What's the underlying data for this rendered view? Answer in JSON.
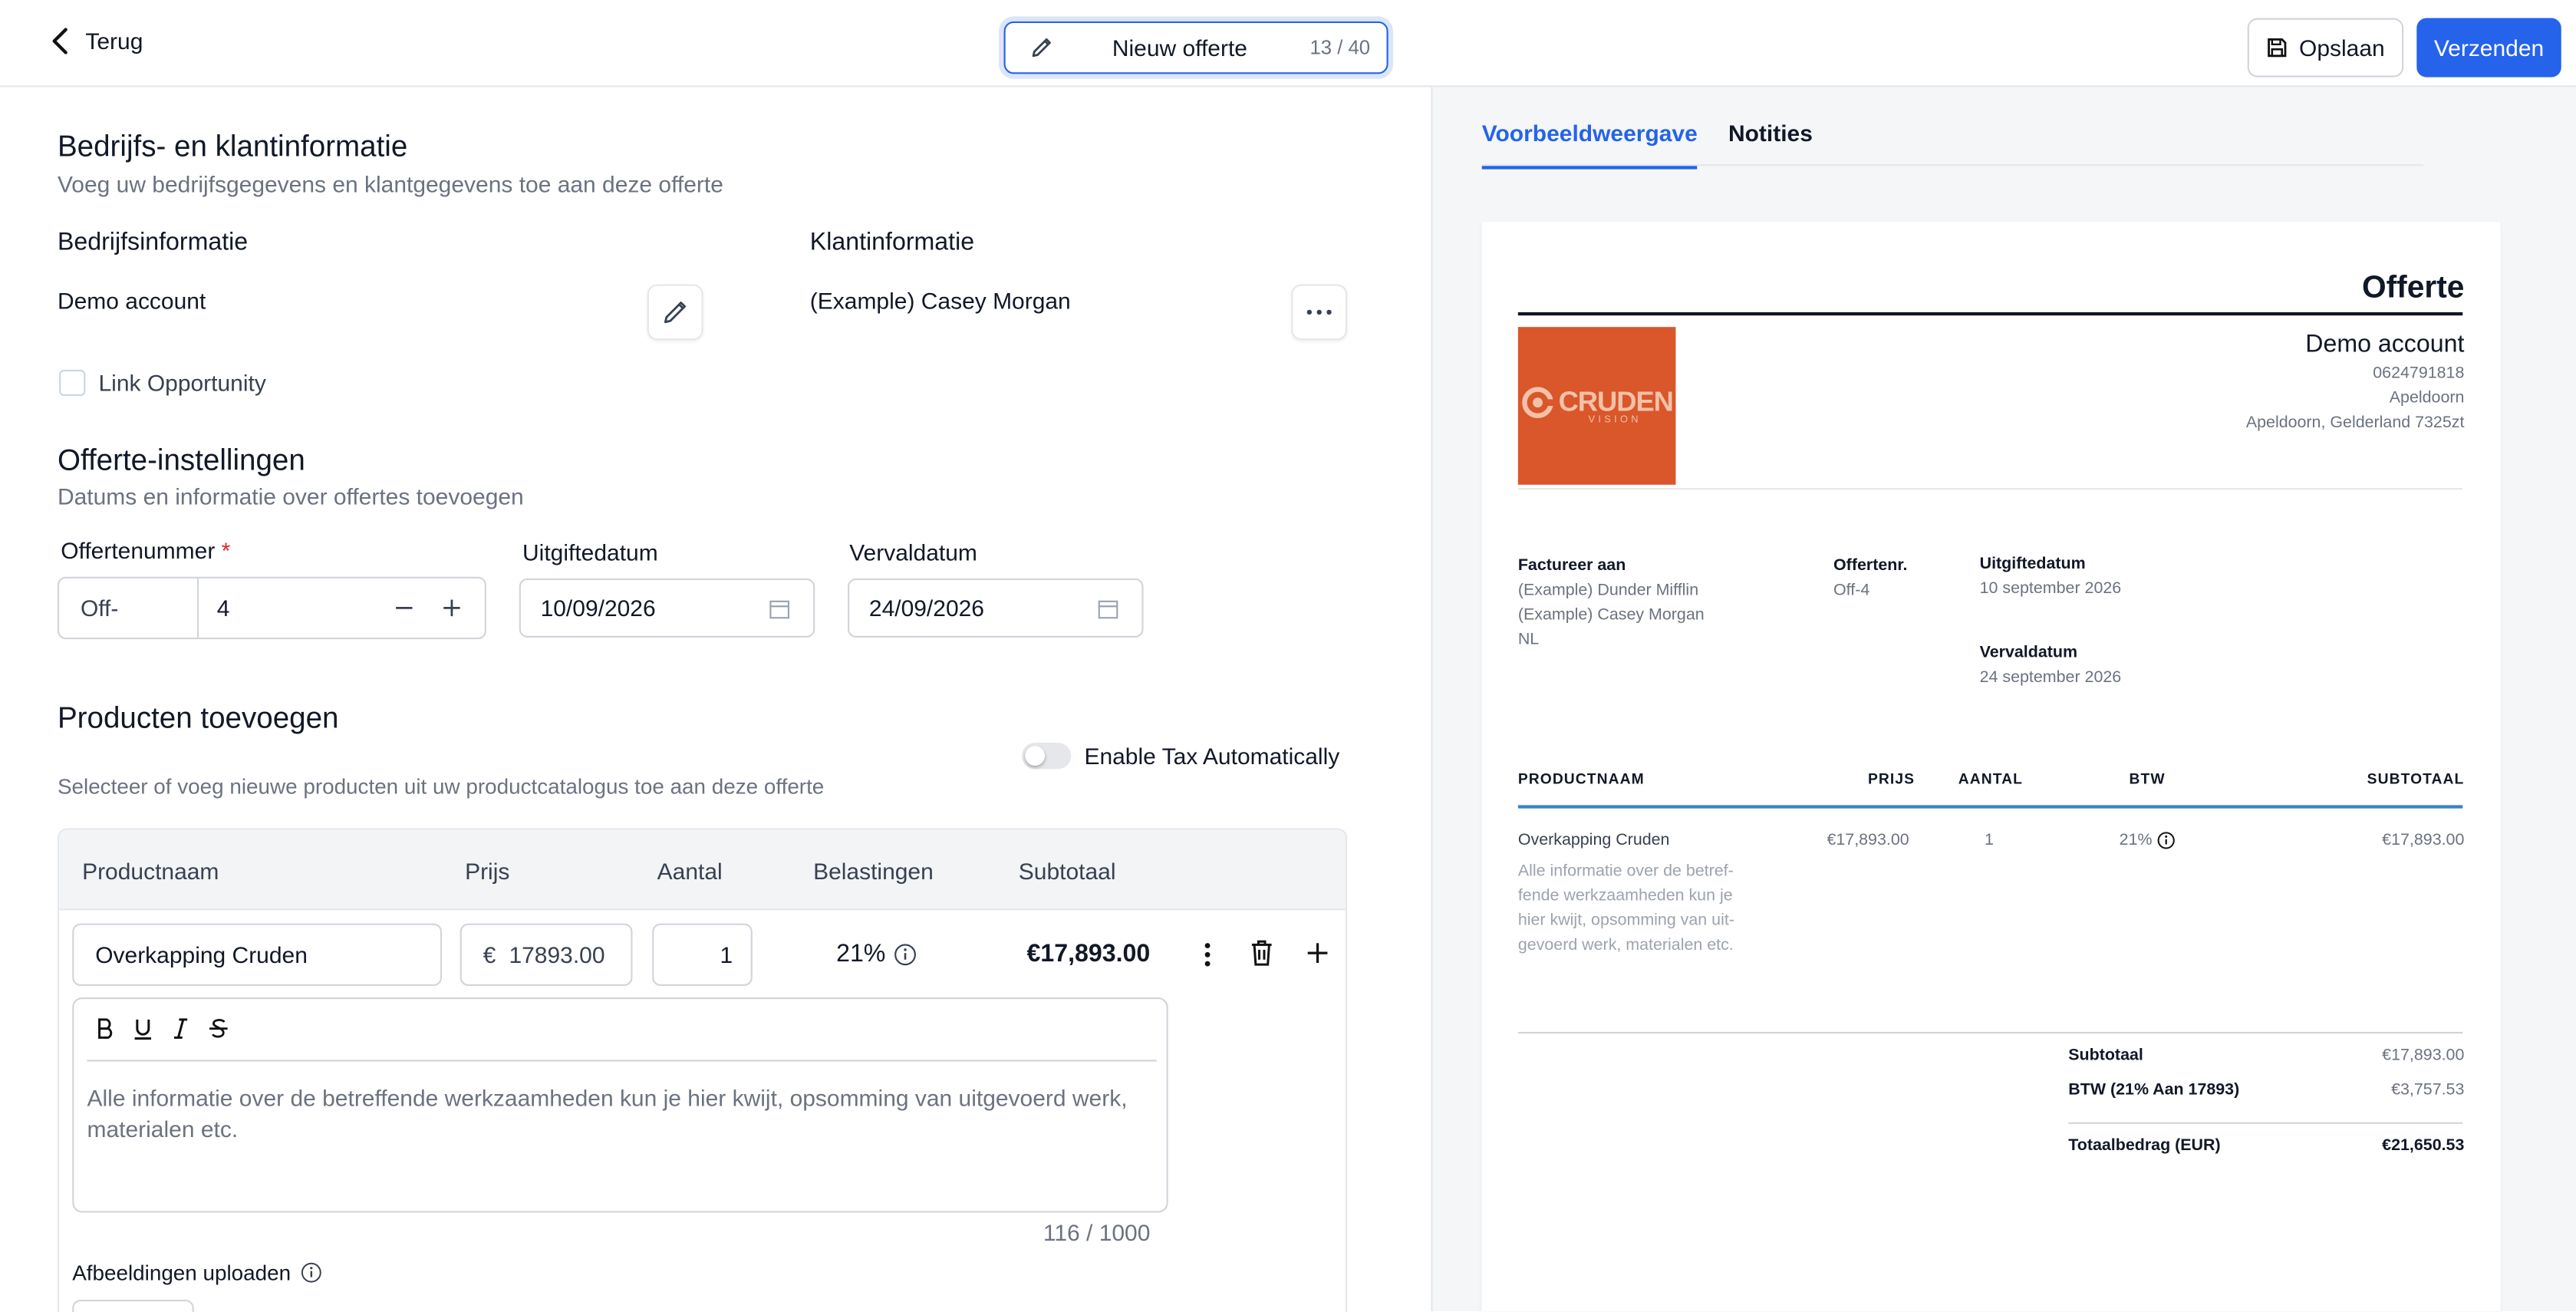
{
  "header": {
    "back_label": "Terug",
    "title_value": "Nieuw offerte",
    "title_counter": "13 / 40",
    "save_label": "Opslaan",
    "send_label": "Verzenden"
  },
  "company_section": {
    "title": "Bedrijfs- en klantinformatie",
    "subtitle": "Voeg uw bedrijfsgegevens en klantgegevens toe aan deze offerte",
    "company_label": "Bedrijfsinformatie",
    "company_name": "Demo account",
    "client_label": "Klantinformatie",
    "client_name": "(Example) Casey Morgan",
    "link_opportunity": "Link Opportunity"
  },
  "settings": {
    "title": "Offerte-instellingen",
    "subtitle": "Datums en informatie over offertes toevoegen",
    "number_label": "Offertenummer",
    "required_mark": "*",
    "number_prefix": "Off-",
    "number_value": "4",
    "issue_label": "Uitgiftedatum",
    "issue_value": "10/09/2026",
    "due_label": "Vervaldatum",
    "due_value": "24/09/2026"
  },
  "products": {
    "title": "Producten toevoegen",
    "subtitle": "Selecteer of voeg nieuwe producten uit uw productcatalogus toe aan deze offerte",
    "tax_toggle_label": "Enable Tax Automatically",
    "tax_toggle_on": false,
    "columns": [
      "Productnaam",
      "Prijs",
      "Aantal",
      "Belastingen",
      "Subtotaal"
    ],
    "row": {
      "name": "Overkapping Cruden",
      "currency": "€",
      "price": "17893.00",
      "qty": "1",
      "tax": "21%",
      "subtotal": "€17,893.00"
    },
    "description_placeholder": "Alle informatie over de betreffende werkzaamheden kun je hier kwijt, opsomming van uitgevoerd werk, materialen etc.",
    "char_count": "116 / 1000",
    "upload_label": "Afbeeldingen uploaden"
  },
  "preview": {
    "tabs": [
      "Voorbeeldweergave",
      "Notities"
    ],
    "doc_title": "Offerte",
    "logo_text": "CRUDEN",
    "logo_sub": "VISION",
    "logo_color": "#d9572a",
    "company_name": "Demo account",
    "company_lines": [
      "0624791818",
      "Apeldoorn",
      "Apeldoorn, Gelderland 7325zt"
    ],
    "bill_to_label": "Factureer aan",
    "bill_to_lines": [
      "(Example) Dunder Mifflin",
      "(Example) Casey Morgan",
      "NL"
    ],
    "number_label": "Offertenr.",
    "number_value": "Off-4",
    "issue_label": "Uitgiftedatum",
    "issue_value": "10 september 2026",
    "due_label": "Vervaldatum",
    "due_value": "24 september 2026",
    "table_headers": [
      "PRODUCTNAAM",
      "PRIJS",
      "AANTAL",
      "BTW",
      "SUBTOTAAL"
    ],
    "item": {
      "name": "Overkapping Cruden",
      "desc_lines": [
        "Alle informatie over de betref-",
        "fende werkzaamheden kun je",
        "hier kwijt, opsomming van uit-",
        "gevoerd werk, materialen etc."
      ],
      "price": "€17,893.00",
      "qty": "1",
      "tax": "21%",
      "subtotal": "€17,893.00"
    },
    "subtotal_label": "Subtotaal",
    "subtotal_value": "€17,893.00",
    "vat_label": "BTW (21% Aan 17893)",
    "vat_value": "€3,757.53",
    "total_label": "Totaalbedrag (EUR)",
    "total_value": "€21,650.53"
  },
  "colors": {
    "accent": "#2563eb",
    "border": "#e5e7eb",
    "preview_bg": "#f5f6f8"
  }
}
